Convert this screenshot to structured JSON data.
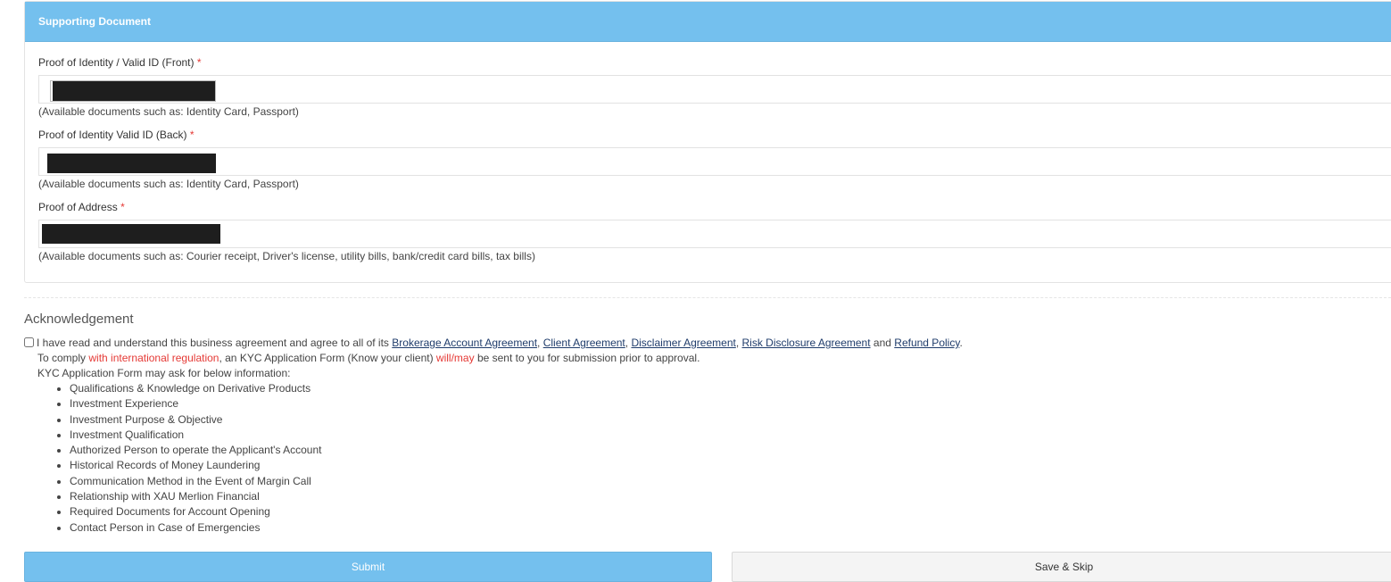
{
  "supporting_document": {
    "header": "Supporting Document",
    "fields": [
      {
        "label": "Proof of Identity / Valid ID (Front)",
        "required_mark": "*",
        "hint": "(Available documents such as: Identity Card, Passport)"
      },
      {
        "label": "Proof of Identity Valid ID (Back)",
        "required_mark": "*",
        "hint": "(Available documents such as: Identity Card, Passport)"
      },
      {
        "label": "Proof of Address",
        "required_mark": "*",
        "hint": "(Available documents such as: Courier receipt, Driver's license, utility bills, bank/credit card bills, tax bills)"
      }
    ]
  },
  "acknowledgement": {
    "title": "Acknowledgement",
    "agree_prefix": "I have read and understand this business agreement and agree to all of its",
    "links": [
      "Brokerage Account Agreement",
      "Client Agreement",
      "Disclaimer Agreement",
      "Risk Disclosure Agreement",
      "Refund Policy"
    ],
    "and_word": "and",
    "period": ".",
    "comply_prefix": "To comply",
    "comply_red1": "with international regulation",
    "comply_mid": ", an KYC Application Form (Know your client)",
    "comply_red2": "will/may",
    "comply_suffix": "be sent to you for submission prior to approval.",
    "kyc_intro": "KYC Application Form may ask for below information:",
    "kyc_items": [
      "Qualifications & Knowledge on Derivative Products",
      "Investment Experience",
      "Investment Purpose & Objective",
      "Investment Qualification",
      "Authorized Person to operate the Applicant's Account",
      "Historical Records of Money Laundering",
      "Communication Method in the Event of Margin Call",
      "Relationship with XAU Merlion Financial",
      "Required Documents for Account Opening",
      "Contact Person in Case of Emergencies"
    ]
  },
  "buttons": {
    "submit": "Submit",
    "save_skip": "Save & Skip"
  },
  "colors": {
    "primary": "#74c0ee",
    "required": "#e53935",
    "link": "#1f3c6b"
  }
}
